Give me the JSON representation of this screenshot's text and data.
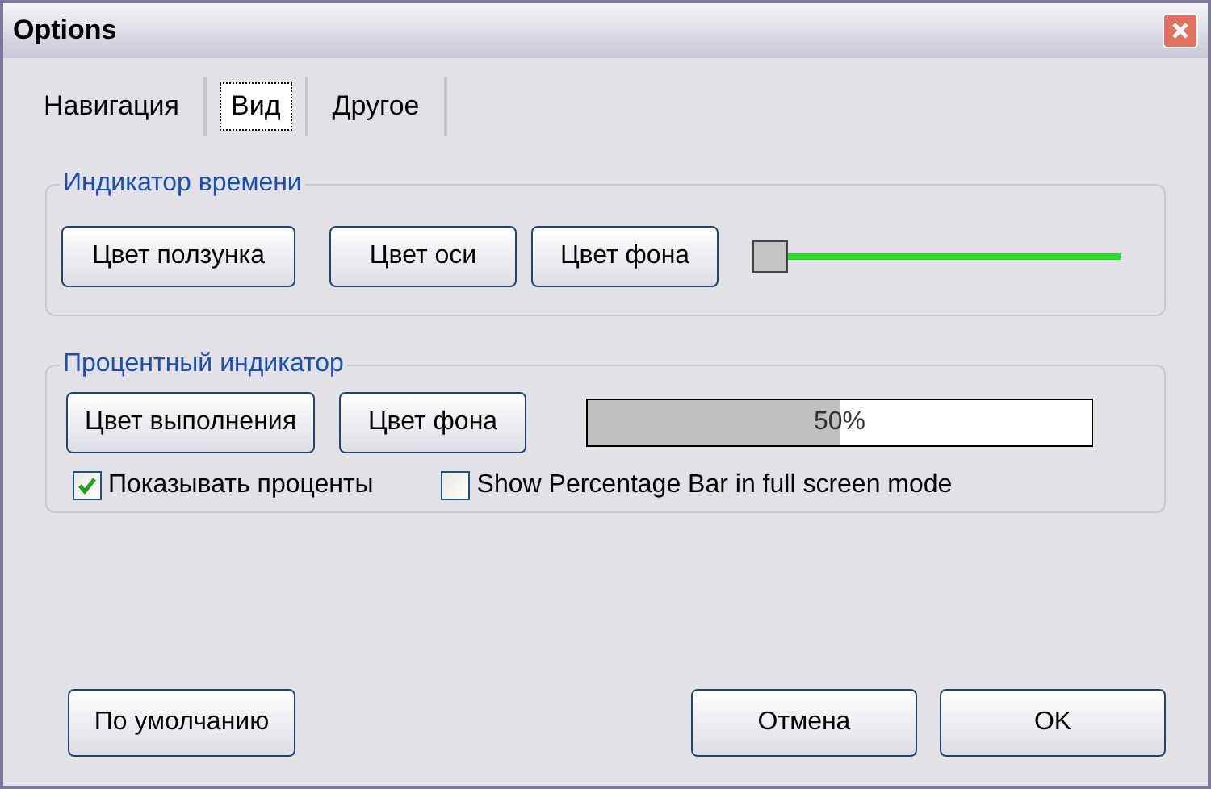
{
  "window": {
    "title": "Options"
  },
  "tabs": [
    {
      "label": "Навигация",
      "selected": false
    },
    {
      "label": "Вид",
      "selected": true
    },
    {
      "label": "Другое",
      "selected": false
    }
  ],
  "time_indicator": {
    "title": "Индикатор времени",
    "buttons": [
      "Цвет ползунка",
      "Цвет оси",
      "Цвет фона"
    ],
    "slider": {
      "level": 0
    }
  },
  "percent_indicator": {
    "title": "Процентный индикатор",
    "buttons": [
      "Цвет выполнения",
      "Цвет фона"
    ],
    "progress": {
      "level": 0.5,
      "reading": "50%"
    },
    "checkboxes": [
      {
        "label": "Показывать проценты",
        "checked": true
      },
      {
        "label": "Show Percentage Bar in full screen mode",
        "checked": false
      }
    ]
  },
  "buttons": {
    "default": "По умолчанию",
    "cancel": "Отмена",
    "ok": "OK"
  }
}
